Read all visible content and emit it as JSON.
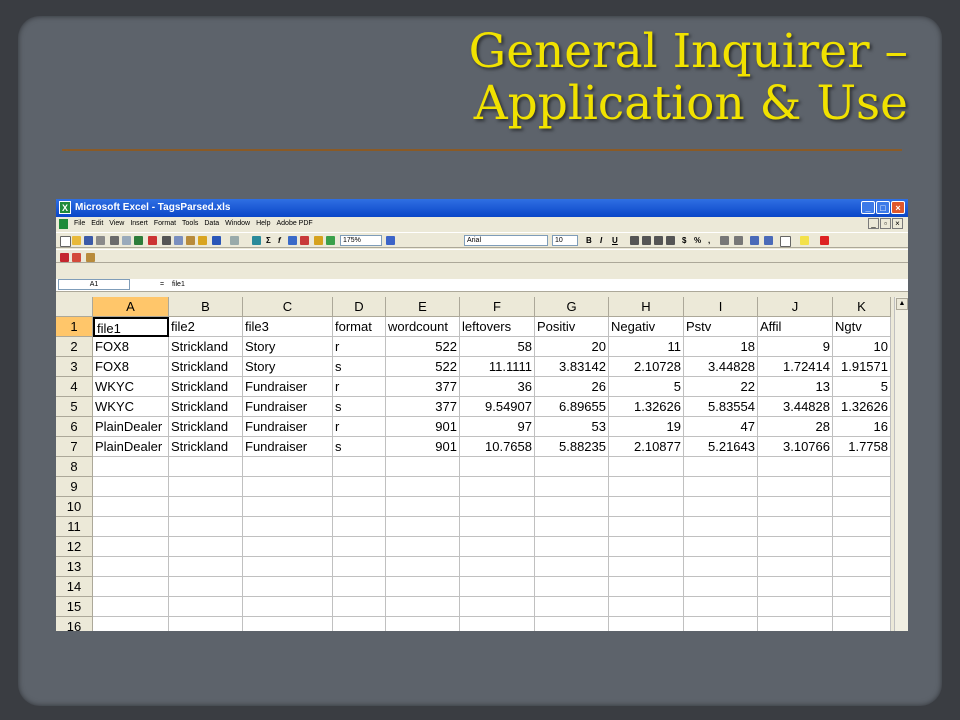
{
  "slide": {
    "title_line1": "General Inquirer –",
    "title_line2": "Application & Use"
  },
  "excel": {
    "window_title": "Microsoft Excel - TagsParsed.xls",
    "menu": [
      "File",
      "Edit",
      "View",
      "Insert",
      "Format",
      "Tools",
      "Data",
      "Window",
      "Help",
      "Adobe PDF"
    ],
    "zoom": "175%",
    "font": "Arial",
    "font_size": "10",
    "name_box": "A1",
    "formula_sign": "=",
    "formula_value": "file1",
    "sheet": {
      "columns": [
        "A",
        "B",
        "C",
        "D",
        "E",
        "F",
        "G",
        "H",
        "I",
        "J",
        "K"
      ],
      "row_numbers": [
        "1",
        "2",
        "3",
        "4",
        "5",
        "6",
        "7",
        "8",
        "9",
        "10",
        "11",
        "12",
        "13",
        "14",
        "15",
        "16"
      ],
      "rows": [
        [
          "file1",
          "file2",
          "file3",
          "format",
          "wordcount",
          "leftovers",
          "Positiv",
          "Negativ",
          "Pstv",
          "Affil",
          "Ngtv"
        ],
        [
          "FOX8",
          "Strickland",
          "Story",
          "r",
          "522",
          "58",
          "20",
          "11",
          "18",
          "9",
          "10"
        ],
        [
          "FOX8",
          "Strickland",
          "Story",
          "s",
          "522",
          "11.1111",
          "3.83142",
          "2.10728",
          "3.44828",
          "1.72414",
          "1.91571"
        ],
        [
          "WKYC",
          "Strickland",
          "Fundraiser",
          "r",
          "377",
          "36",
          "26",
          "5",
          "22",
          "13",
          "5"
        ],
        [
          "WKYC",
          "Strickland",
          "Fundraiser",
          "s",
          "377",
          "9.54907",
          "6.89655",
          "1.32626",
          "5.83554",
          "3.44828",
          "1.32626"
        ],
        [
          "PlainDealer",
          "Strickland",
          "Fundraiser",
          "r",
          "901",
          "97",
          "53",
          "19",
          "47",
          "28",
          "16"
        ],
        [
          "PlainDealer",
          "Strickland",
          "Fundraiser",
          "s",
          "901",
          "10.7658",
          "5.88235",
          "2.10877",
          "5.21643",
          "3.10766",
          "1.7758"
        ]
      ]
    }
  }
}
